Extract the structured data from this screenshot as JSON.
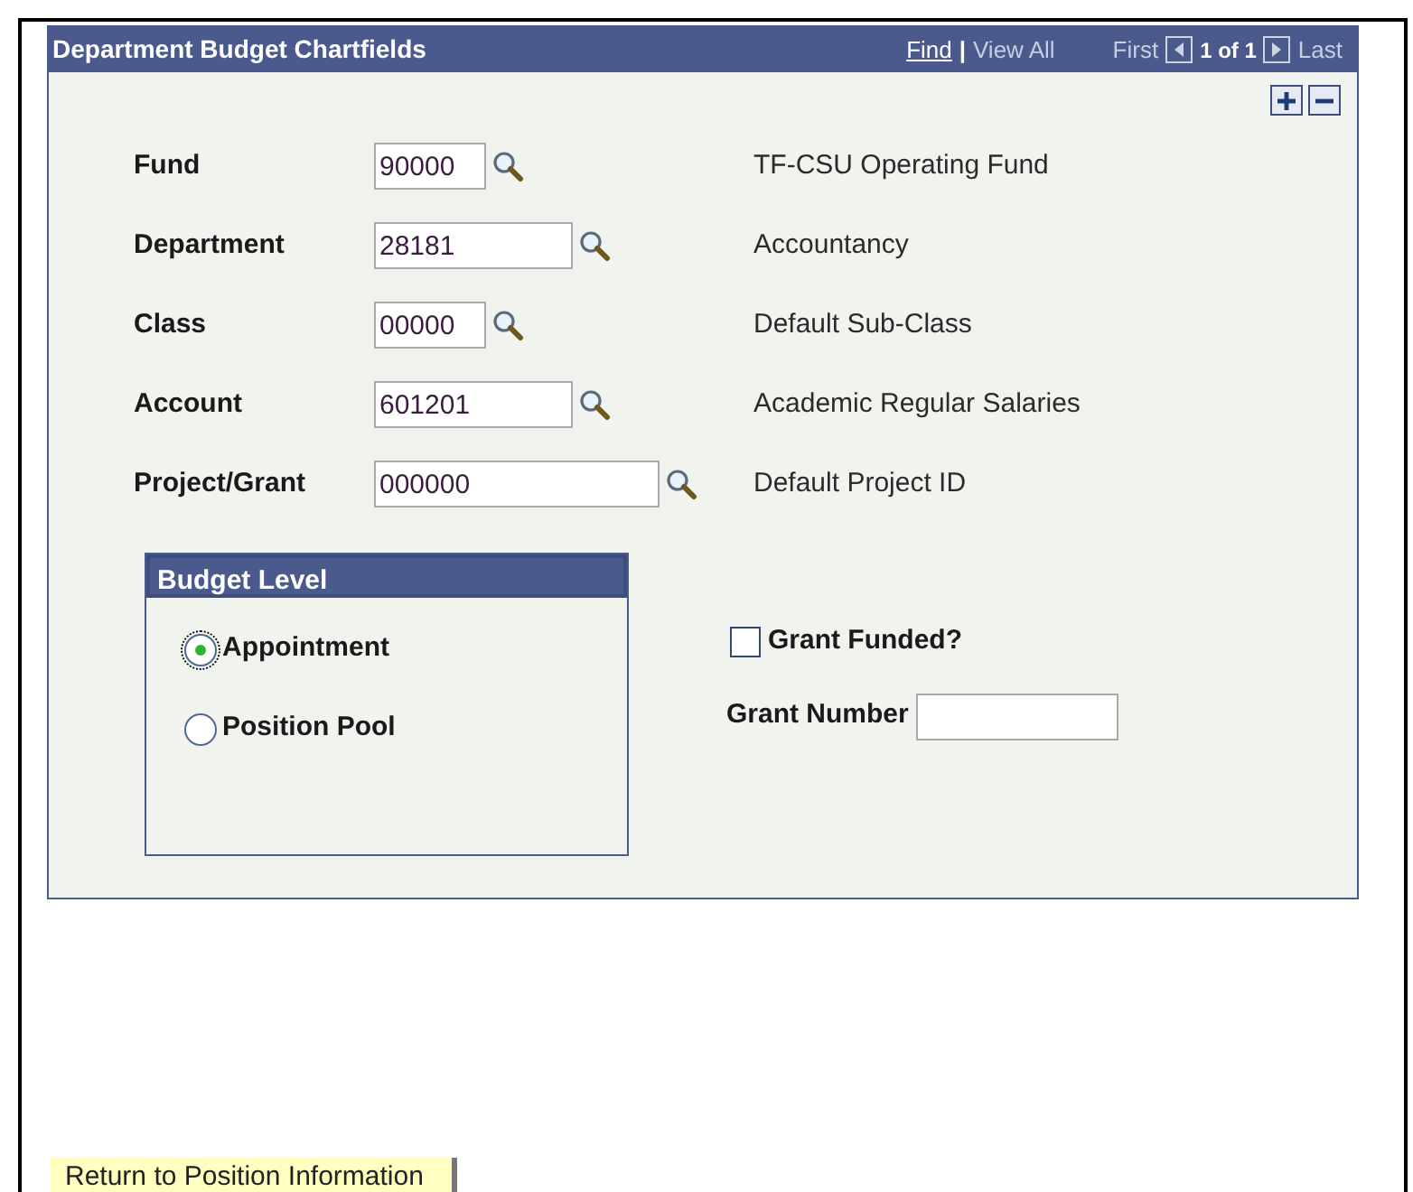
{
  "panel": {
    "title": "Department Budget Chartfields",
    "find": "Find",
    "separator": "|",
    "view_all": "View All",
    "first": "First",
    "counter": "1 of 1",
    "last": "Last"
  },
  "fields": [
    {
      "label": "Fund",
      "value": "90000",
      "description": "TF-CSU Operating Fund"
    },
    {
      "label": "Department",
      "value": "28181",
      "description": "Accountancy"
    },
    {
      "label": "Class",
      "value": "00000",
      "description": "Default Sub-Class"
    },
    {
      "label": "Account",
      "value": "601201",
      "description": "Academic Regular Salaries"
    },
    {
      "label": "Project/Grant",
      "value": "000000",
      "description": "Default Project ID"
    }
  ],
  "budget_level": {
    "title": "Budget Level",
    "options": [
      {
        "label": "Appointment",
        "selected": true,
        "focused": true
      },
      {
        "label": "Position Pool",
        "selected": false,
        "focused": false
      }
    ]
  },
  "grant_funded": {
    "label": "Grant Funded?",
    "checked": false
  },
  "grant_number": {
    "label": "Grant Number"
  },
  "return_button": "Return to Position Information"
}
